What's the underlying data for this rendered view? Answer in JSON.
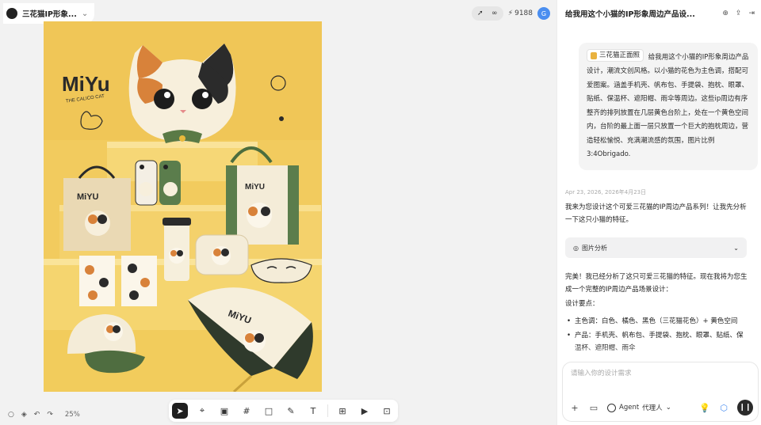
{
  "project": {
    "title": "三花猫IP形象...",
    "credits": "9188",
    "avatar_letter": "G"
  },
  "artwork": {
    "brand": "MiYu",
    "tagline": "THE CALICO CAT"
  },
  "canvas": {
    "zoom": "25%"
  },
  "chat": {
    "title": "给我用这个小猫的IP形象周边产品设...",
    "user_message": {
      "ref_chip": "三花猫正面照",
      "text": "给我用这个小猫的IP形象周边产品设计，潮流文创风格。以小猫的花色为主色调，搭配可爱图案。涵盖手机壳、帆布包、手提袋、抱枕、眼罩、贴纸、保温杯、遮阳帽、雨伞等周边。这些ip周边有序整齐的排列放置在几层黄色台阶上，处在一个黄色空间内，台阶的最上面一层只放置一个巨大的抱枕周边，营造轻松愉悦、充满潮流感的氛围，图片比例3:4Obrigado."
    },
    "date": "Apr 23, 2026, 2026年4月23日",
    "ai_intro": "我来为您设计这个可爱三花猫的IP周边产品系列！让我先分析一下这只小猫的特征。",
    "analysis_label": "图片分析",
    "ai_done": "完美！我已经分析了这只可爱三花猫的特征。现在我将为您生成一个完整的IP周边产品场景设计：",
    "points_title": "设计要点：",
    "bullets": [
      "主色调：白色、橘色、黑色（三花猫花色）+ 黄色空间",
      "产品：手机壳、帆布包、手提袋、抱枕、眼罩、贴纸、保温杯、遮阳帽、雨伞"
    ],
    "input_placeholder": "请输入你的设计需求",
    "agent_label": "Agent",
    "agent_mode": "代理人"
  }
}
